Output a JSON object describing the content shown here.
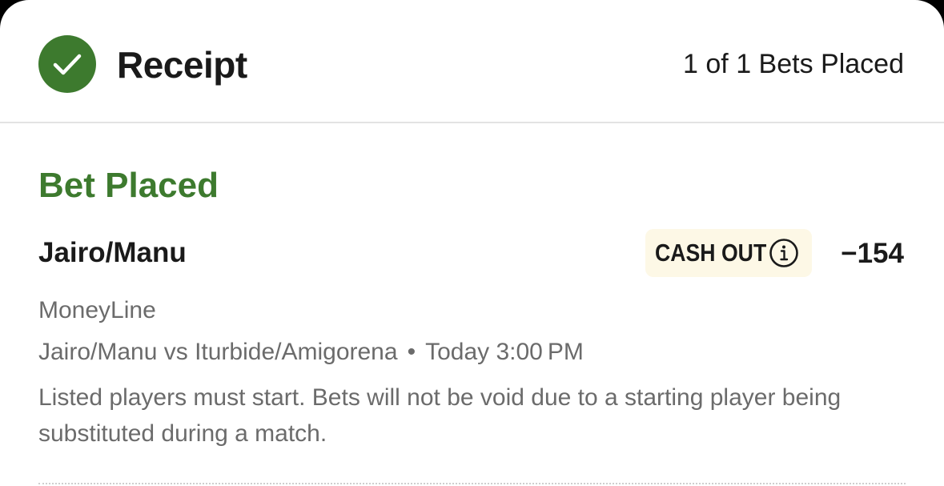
{
  "header": {
    "title": "Receipt",
    "bets_count": "1 of 1 Bets Placed"
  },
  "bet": {
    "status": "Bet Placed",
    "selection": "Jairo/Manu",
    "cash_out_label": "CASH OUT",
    "odds": "−154",
    "market": "MoneyLine",
    "matchup": "Jairo/Manu vs Iturbide/Amigorena",
    "separator": "•",
    "start_time": "Today 3:00 PM",
    "rules_text": "Listed players must start. Bets will not be void due to a starting player being substituted during a match."
  },
  "colors": {
    "success_green": "#3d7a2e",
    "cash_out_bg": "#fdf8e6",
    "text_primary": "#1a1a1a",
    "text_secondary": "#6b6b6b"
  },
  "icons": {
    "status": "check-circle-icon",
    "cash_out_info": "info-icon"
  }
}
